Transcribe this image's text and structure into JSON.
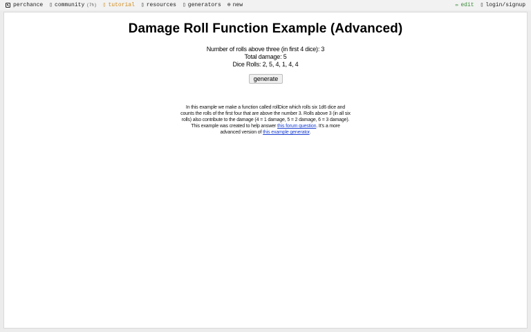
{
  "nav": {
    "left": [
      {
        "name": "perchance-logo-link",
        "icon": "die-icon",
        "label": "perchance"
      },
      {
        "name": "community-link",
        "icon": "chat-icon",
        "glyph": "▯",
        "label": "community",
        "count": "(7h)"
      },
      {
        "name": "tutorial-link",
        "icon": "book-icon",
        "glyph": "▯",
        "label": "tutorial",
        "active": true
      },
      {
        "name": "resources-link",
        "icon": "folder-icon",
        "glyph": "▯",
        "label": "resources"
      },
      {
        "name": "generators-link",
        "icon": "list-icon",
        "glyph": "▯",
        "label": "generators"
      },
      {
        "name": "new-link",
        "icon": "plus-circle-icon",
        "glyph": "⊕",
        "label": "new"
      }
    ],
    "right": [
      {
        "name": "edit-link",
        "icon": "pencil-icon",
        "glyph": "✏",
        "label": "edit"
      },
      {
        "name": "login-signup-link",
        "icon": "user-icon",
        "glyph": "▯",
        "label": "login/signup"
      }
    ]
  },
  "main": {
    "title": "Damage Roll Function Example (Advanced)",
    "output": {
      "rolls_above_three": "Number of rolls above three (in first 4 dice): 3",
      "total_damage": "Total damage: 5",
      "dice_rolls": "Dice Rolls: 2, 5, 4, 1, 4, 4"
    },
    "generate_label": "generate",
    "description": {
      "text1": "In this example we make a function called rollDice which rolls six 1d6 dice and counts the rolls of the first four that are above the number 3. Rolls above 3 (in all six rolls) also contribute to the damage (4 = 1 damage, 5 = 2 damage, 6 = 3 damage). This example was created to help answer ",
      "link1": "this forum question",
      "text2": ". It's a more advanced version of ",
      "link2": "this example generator",
      "text3": "."
    }
  },
  "colors": {
    "active_nav": "#d08a1c",
    "edit_nav": "#3a8a3a",
    "link": "#1a3fd1"
  }
}
